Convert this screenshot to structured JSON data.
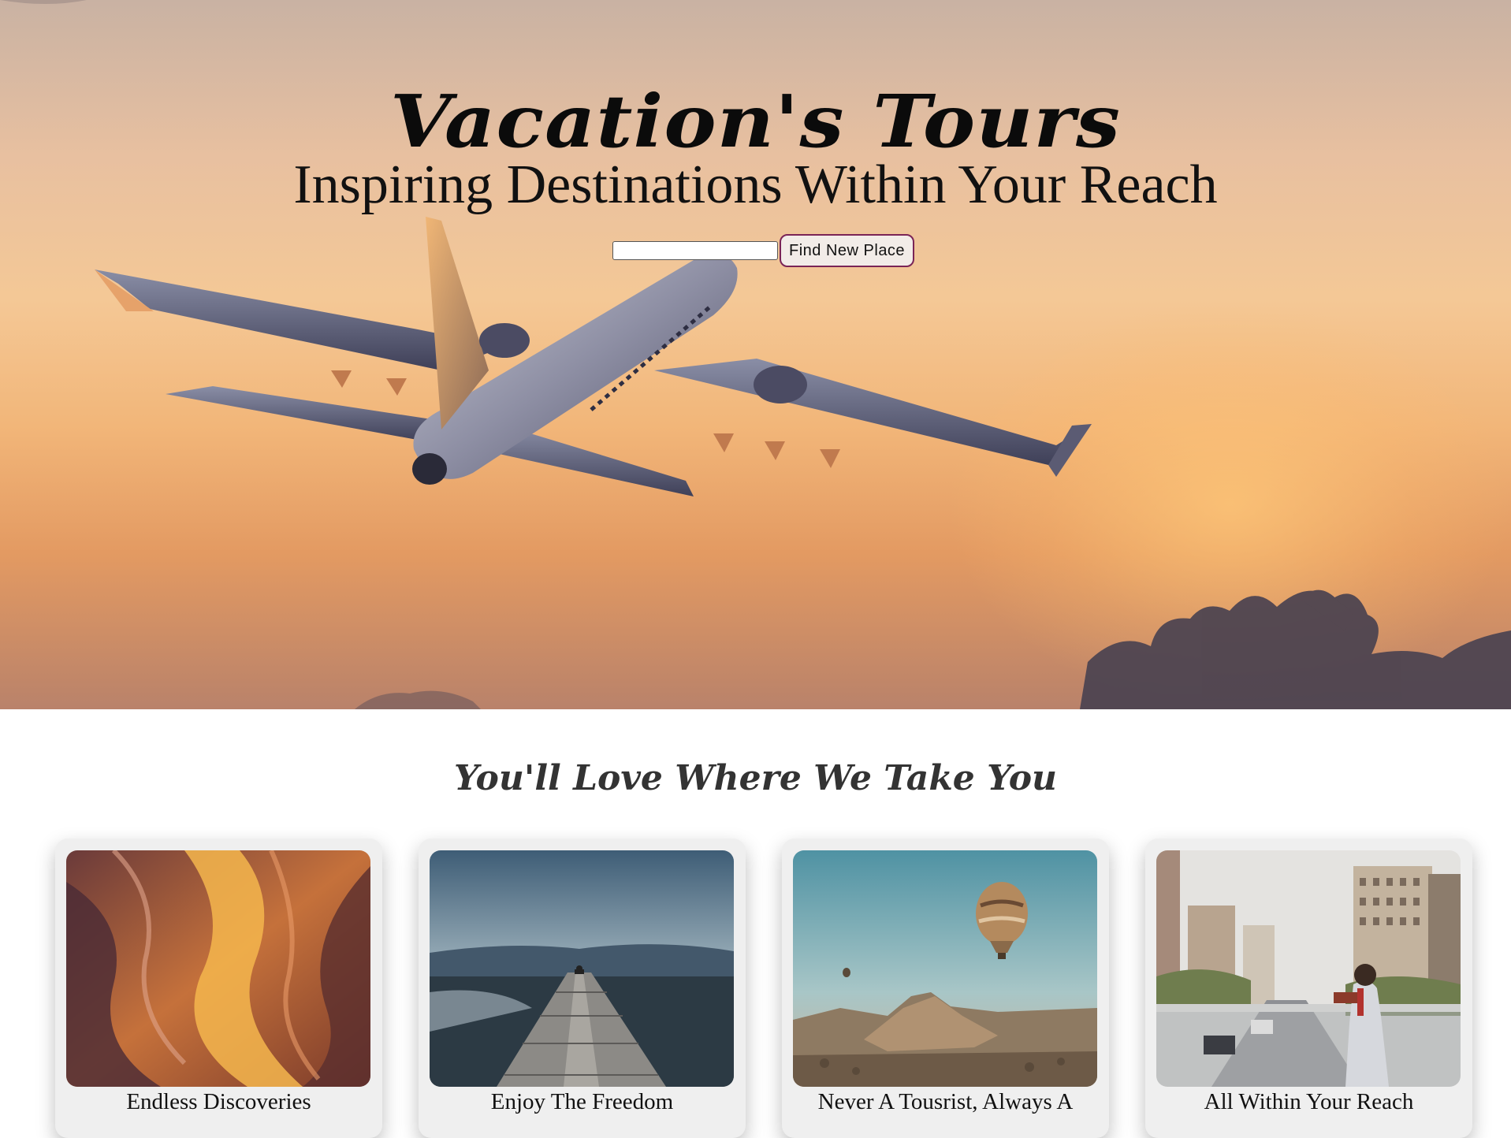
{
  "hero": {
    "title": "Vacation's Tours",
    "subtitle": "Inspiring Destinations Within Your Reach",
    "search_value": "",
    "search_button": "Find New Place"
  },
  "section": {
    "title": "You'll Love Where We Take You"
  },
  "cards": [
    {
      "caption": "Endless Discoveries",
      "image": "slot-canyon-photo"
    },
    {
      "caption": "Enjoy The Freedom",
      "image": "mountain-pier-photo"
    },
    {
      "caption": "Never A Tousrist, Always A",
      "image": "hot-air-balloon-photo"
    },
    {
      "caption": "All Within Your Reach",
      "image": "city-street-reader-photo"
    }
  ]
}
